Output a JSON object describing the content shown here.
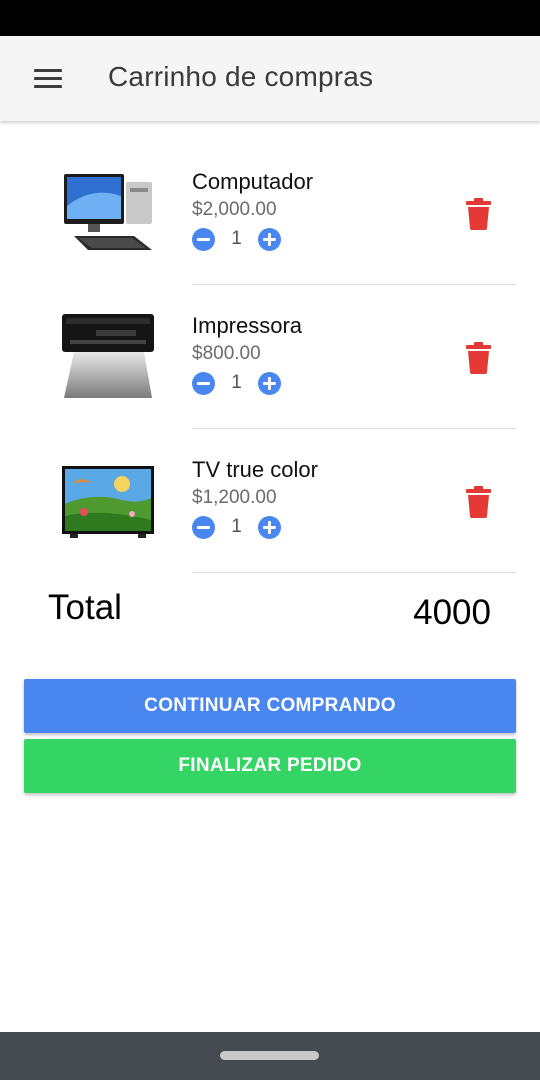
{
  "header": {
    "title": "Carrinho de compras",
    "menu_icon": "menu-icon"
  },
  "cart": {
    "items": [
      {
        "name": "Computador",
        "price": "$2,000.00",
        "quantity": "1",
        "image": "computer-image"
      },
      {
        "name": "Impressora",
        "price": "$800.00",
        "quantity": "1",
        "image": "printer-image"
      },
      {
        "name": "TV true color",
        "price": "$1,200.00",
        "quantity": "1",
        "image": "tv-image"
      }
    ]
  },
  "summary": {
    "total_label": "Total",
    "total_value": "4000"
  },
  "actions": {
    "continue_label": "CONTINUAR COMPRANDO",
    "finish_label": "FINALIZAR PEDIDO"
  },
  "colors": {
    "primary": "#4a86f0",
    "success": "#35d565",
    "danger": "#e53935"
  }
}
